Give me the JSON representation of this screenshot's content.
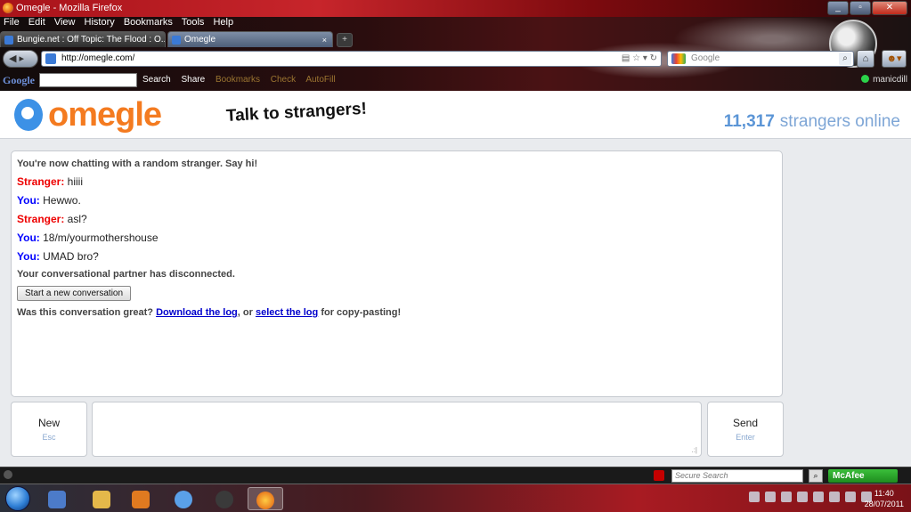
{
  "window": {
    "title": "Omegle - Mozilla Firefox"
  },
  "menu": [
    "File",
    "Edit",
    "View",
    "History",
    "Bookmarks",
    "Tools",
    "Help"
  ],
  "tabs": [
    {
      "label": "Bungie.net : Off Topic: The Flood : O..."
    },
    {
      "label": "Omegle"
    }
  ],
  "nav": {
    "url": "http://omegle.com/",
    "search_placeholder": "Google"
  },
  "gtoolbar": {
    "logo": "Google",
    "items": [
      "Search",
      "Share",
      "Bookmarks",
      "Check",
      "AutoFill"
    ],
    "user": "manicdill"
  },
  "omegle": {
    "logo_text": "omegle",
    "tagline": "Talk to strangers!",
    "online_count": "11,317",
    "online_label": "strangers online"
  },
  "chat": {
    "status_start": "You're now chatting with a random stranger. Say hi!",
    "messages": [
      {
        "who": "Stranger:",
        "text": " hiiii"
      },
      {
        "who": "You:",
        "text": " Hewwo."
      },
      {
        "who": "Stranger:",
        "text": " asl?"
      },
      {
        "who": "You:",
        "text": " 18/m/yourmothershouse"
      },
      {
        "who": "You:",
        "text": " UMAD bro?"
      }
    ],
    "status_end": "Your conversational partner has disconnected.",
    "new_conv_label": "Start a new conversation",
    "great_prefix": "Was this conversation great?",
    "download_link": "Download the log",
    "great_mid": ", or",
    "select_link": "select the log",
    "great_suffix": "for copy-pasting!"
  },
  "controls": {
    "new_label": "New",
    "new_key": "Esc",
    "send_label": "Send",
    "send_key": "Enter",
    "grip": ".:|"
  },
  "statusbar": {
    "secure_search_placeholder": "Secure Search",
    "mcafee_label": "McAfee"
  },
  "taskbar": {
    "time": "11:40",
    "date": "28/07/2011"
  }
}
